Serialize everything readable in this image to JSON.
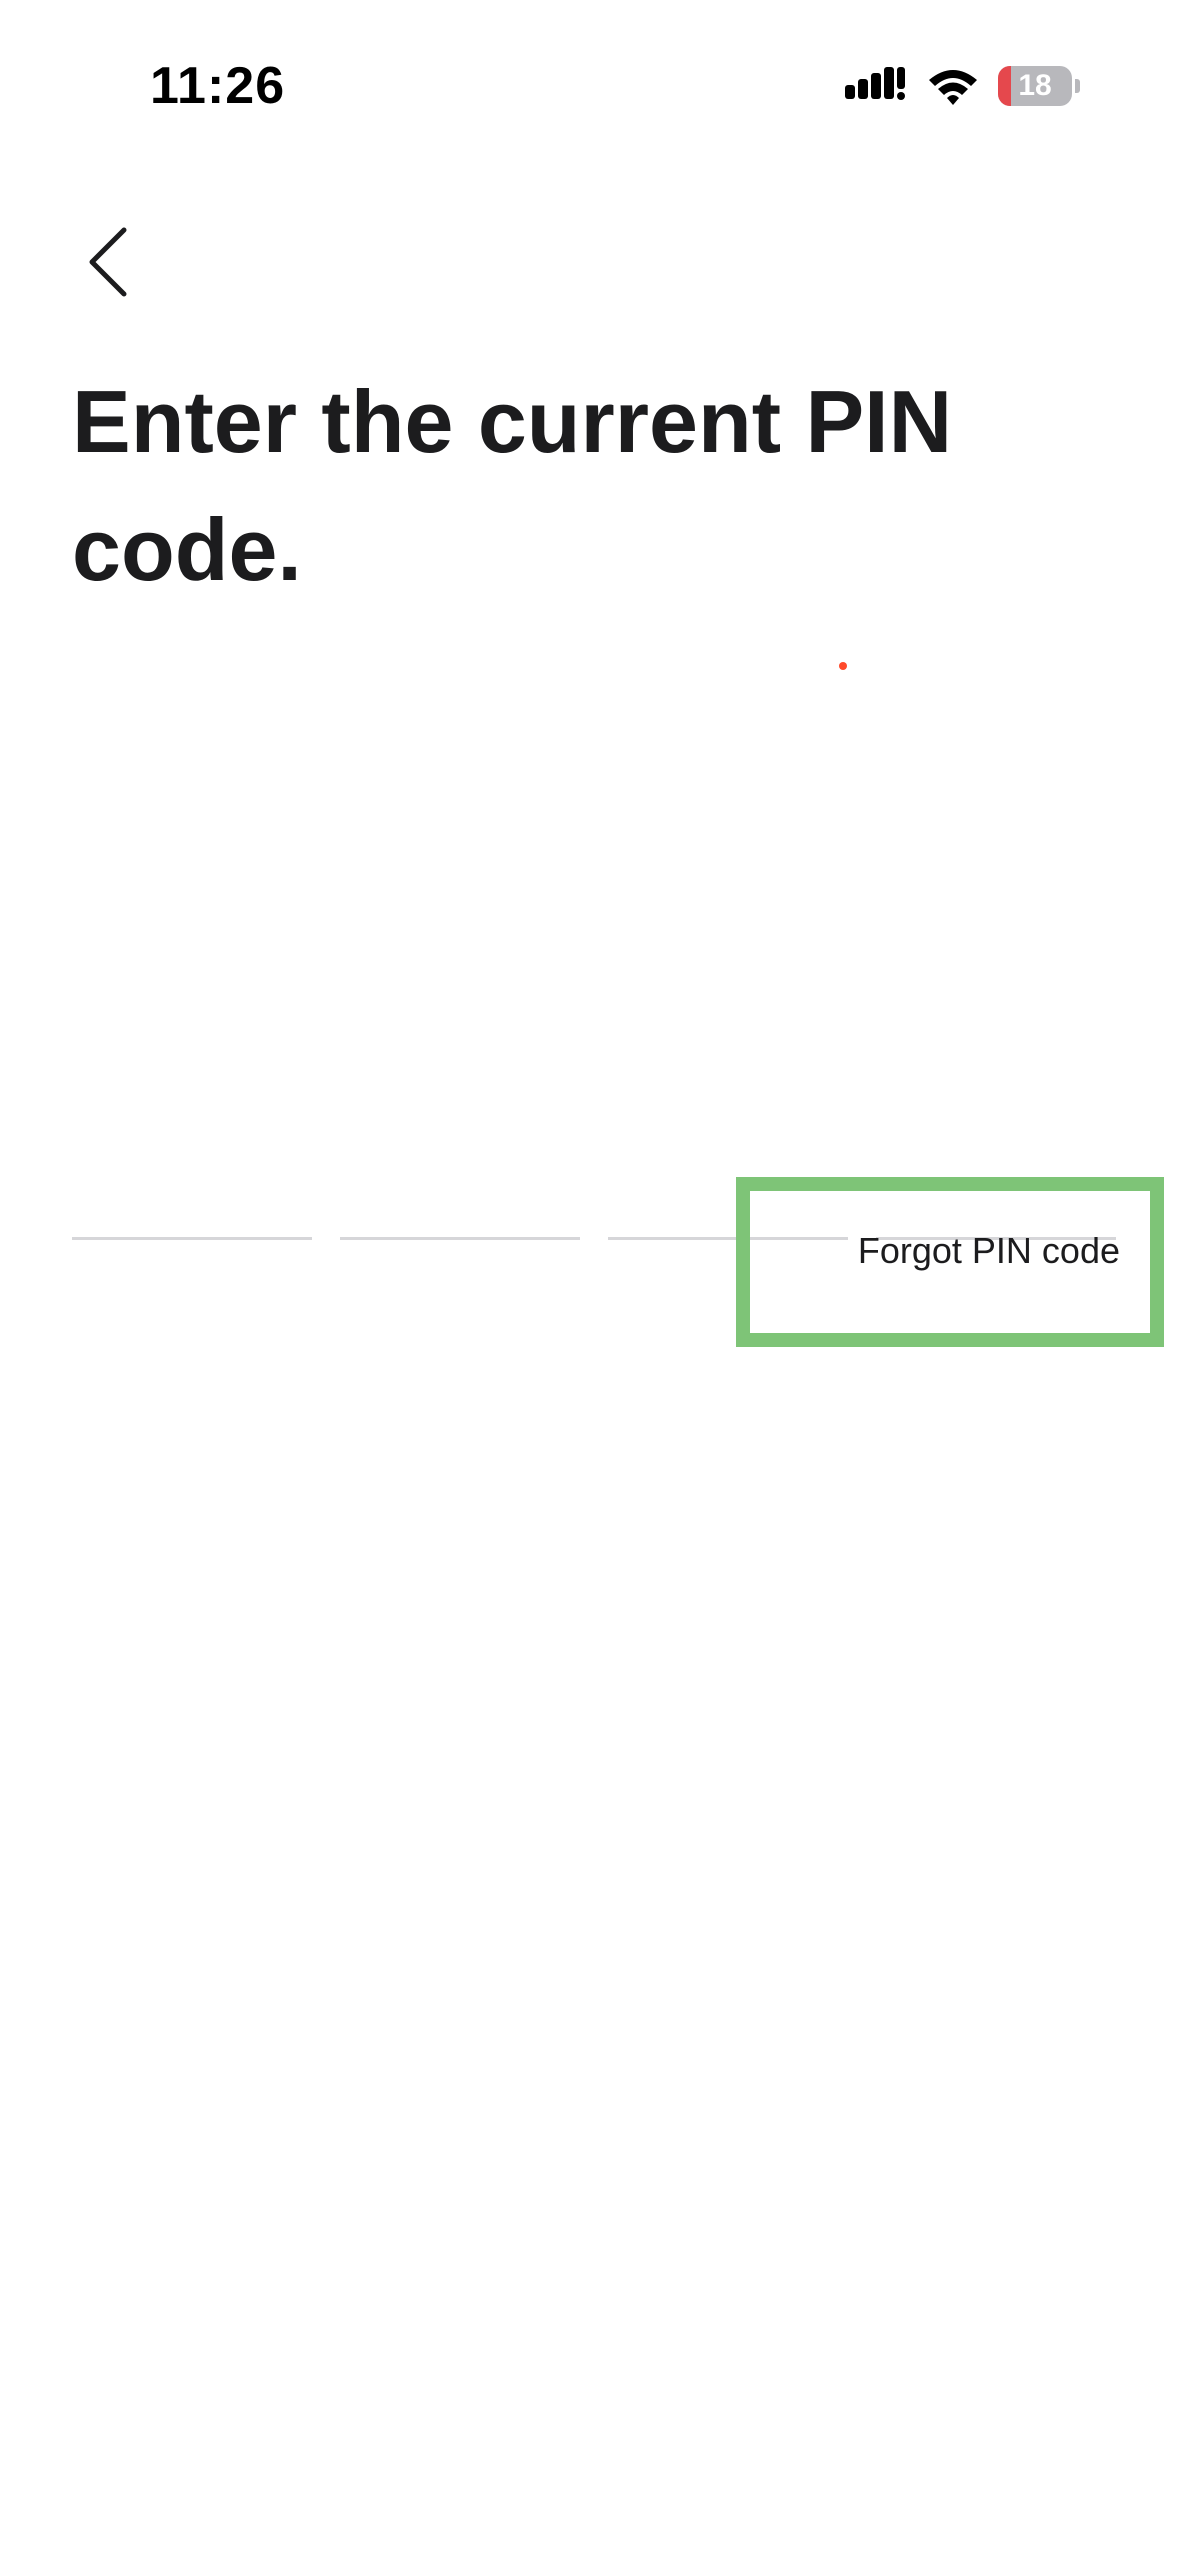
{
  "status_bar": {
    "time": "11:26",
    "battery_level": "18",
    "battery_fraction": 0.18,
    "icons": [
      "signal-icon",
      "wifi-icon",
      "battery-icon"
    ]
  },
  "navigation": {
    "back_icon": "chevron-left-icon"
  },
  "title": "Enter the current PIN code.",
  "pin": {
    "length": 4,
    "entered": ""
  },
  "forgot_link": "Forgot PIN code",
  "colors": {
    "accent_dot": "#ff4a2b",
    "highlight": "#7ec477",
    "battery_low": "#e5484d",
    "text": "#1c1c1e"
  }
}
